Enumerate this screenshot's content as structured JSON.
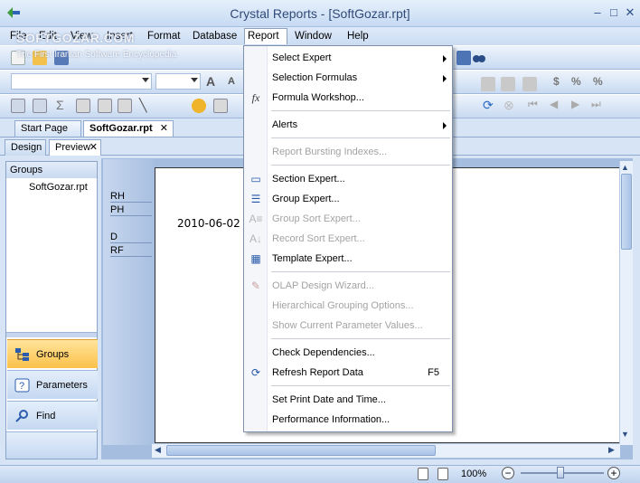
{
  "window": {
    "title": "Crystal Reports - [SoftGozar.rpt]",
    "buttons": {
      "minimize": "–",
      "restore": "□",
      "close": "✕"
    }
  },
  "menubar": {
    "items": [
      "File",
      "Edit",
      "View",
      "Insert",
      "Format",
      "Database",
      "Report",
      "Window",
      "Help"
    ],
    "active": "Report"
  },
  "watermark": {
    "main": "SOFTGOZAR.COM",
    "sub": "The First Iranian Software Encyclopedia"
  },
  "doc_tabs": {
    "start": "Start Page",
    "current": "SoftGozar.rpt",
    "close": "✕"
  },
  "view_tabs": {
    "design": "Design",
    "preview": "Preview",
    "close": "✕"
  },
  "left_panel": {
    "header": "Groups",
    "tree_item": "SoftGozar.rpt",
    "nav": [
      {
        "label": "Groups",
        "icon": "groups-icon",
        "selected": true
      },
      {
        "label": "Parameters",
        "icon": "parameters-icon",
        "selected": false
      },
      {
        "label": "Find",
        "icon": "find-icon",
        "selected": false
      }
    ]
  },
  "sections": [
    "RH",
    "PH",
    "D",
    "RF"
  ],
  "report": {
    "date_field": "2010-06-02"
  },
  "status": {
    "zoom": "100%",
    "zoom_out": "−",
    "zoom_in": "+"
  },
  "report_menu": {
    "items": [
      {
        "label": "Select Expert",
        "submenu": true,
        "disabled": false,
        "icon": ""
      },
      {
        "label": "Selection Formulas",
        "submenu": true,
        "disabled": false,
        "icon": ""
      },
      {
        "label": "Formula Workshop...",
        "disabled": false,
        "icon": "fx-icon"
      },
      {
        "label": "Alerts",
        "submenu": true,
        "disabled": false,
        "icon": ""
      },
      {
        "label": "Report Bursting Indexes...",
        "disabled": true,
        "icon": ""
      },
      {
        "label": "Section Expert...",
        "disabled": false,
        "icon": "section-expert-icon"
      },
      {
        "label": "Group Expert...",
        "disabled": false,
        "icon": "group-expert-icon"
      },
      {
        "label": "Group Sort Expert...",
        "disabled": true,
        "icon": "group-sort-icon"
      },
      {
        "label": "Record Sort Expert...",
        "disabled": true,
        "icon": "record-sort-icon"
      },
      {
        "label": "Template Expert...",
        "disabled": false,
        "icon": "template-icon"
      },
      {
        "label": "OLAP Design Wizard...",
        "disabled": true,
        "icon": "olap-icon"
      },
      {
        "label": "Hierarchical Grouping Options...",
        "disabled": true,
        "icon": ""
      },
      {
        "label": "Show Current Parameter Values...",
        "disabled": true,
        "icon": ""
      },
      {
        "label": "Check Dependencies...",
        "disabled": false,
        "icon": ""
      },
      {
        "label": "Refresh Report Data",
        "shortcut": "F5",
        "disabled": false,
        "icon": "refresh-icon"
      },
      {
        "label": "Set Print Date and Time...",
        "disabled": false,
        "icon": ""
      },
      {
        "label": "Performance Information...",
        "disabled": false,
        "icon": ""
      }
    ]
  }
}
